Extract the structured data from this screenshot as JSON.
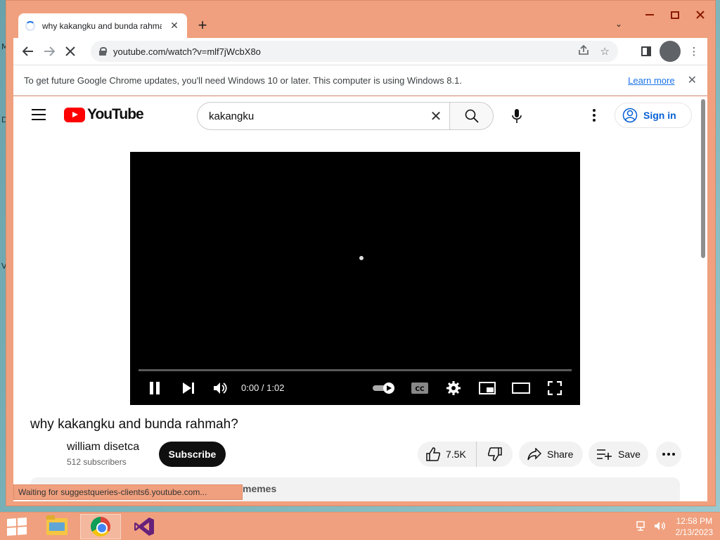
{
  "browser": {
    "tab_title": "why kakangku and bunda rahmah?",
    "url": "youtube.com/watch?v=mlf7jWcbX8o",
    "new_tab_glyph": "+",
    "infobar_text": "To get future Google Chrome updates, you'll need Windows 10 or later. This computer is using Windows 8.1.",
    "infobar_link": "Learn more",
    "status_text": "Waiting for suggestqueries-clients6.youtube.com..."
  },
  "youtube": {
    "logo_text": "YouTube",
    "search_value": "kakangku",
    "signin_label": "Sign in"
  },
  "player": {
    "time": "0:00 / 1:02",
    "progress": 0
  },
  "video": {
    "title": "why kakangku and bunda rahmah?",
    "channel": "william disetca",
    "subscribers": "512 subscribers",
    "subscribe_label": "Subscribe",
    "likes": "7.5K",
    "share_label": "Share",
    "save_label": "Save",
    "description_snippet": "memes"
  },
  "desktop": {
    "letters": [
      "M",
      "D",
      "V"
    ]
  },
  "taskbar": {
    "time": "12:58 PM",
    "date": "2/13/2023"
  },
  "colors": {
    "accent": "#f0a07e",
    "youtube_red": "#ff0000",
    "link_blue": "#1a73e8",
    "signin_blue": "#065fd4"
  },
  "icons": [
    "spinner-icon",
    "close-icon",
    "back-icon",
    "forward-icon",
    "stop-icon",
    "lock-icon",
    "share-page-icon",
    "star-icon",
    "side-panel-icon",
    "profile-icon",
    "kebab-icon",
    "hamburger-icon",
    "search-icon",
    "mic-icon",
    "user-circle-icon",
    "pause-icon",
    "next-icon",
    "volume-icon",
    "autoplay-icon",
    "cc-icon",
    "settings-icon",
    "miniplayer-icon",
    "theater-icon",
    "fullscreen-icon",
    "thumbs-up-icon",
    "thumbs-down-icon",
    "share-icon",
    "playlist-add-icon"
  ]
}
